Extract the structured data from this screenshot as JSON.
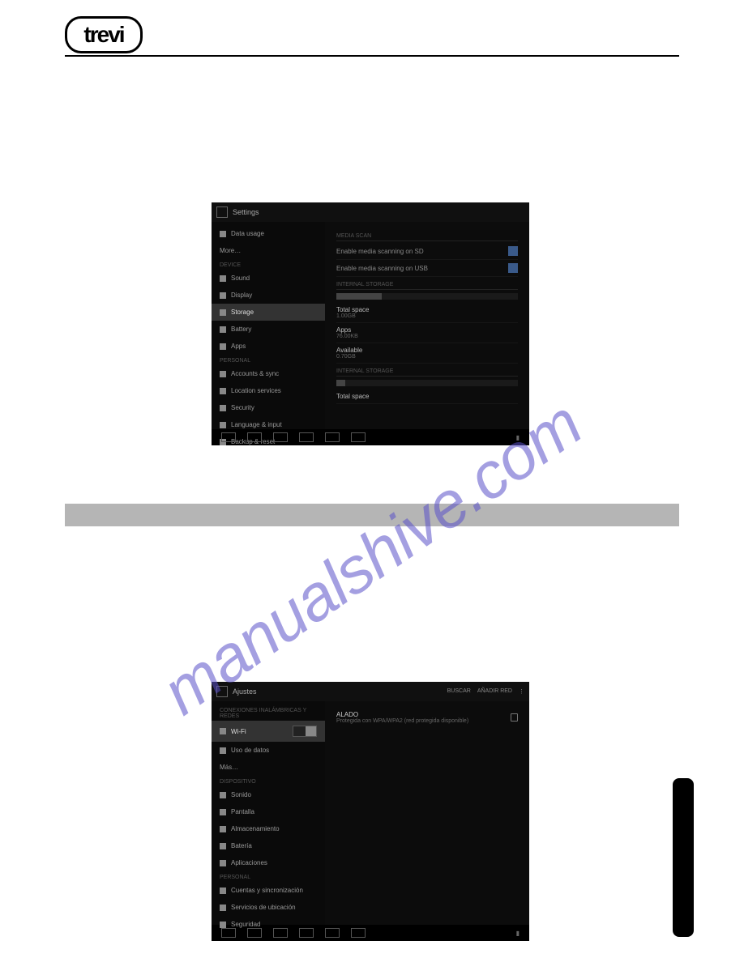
{
  "brand_logo_text": "trevi",
  "watermark_text": "manualshive.com",
  "screenshot1": {
    "title": "Settings",
    "left_items": [
      {
        "label": "Data usage",
        "category": false,
        "selected": false
      },
      {
        "label": "More…",
        "category": false,
        "selected": false
      },
      {
        "label": "DEVICE",
        "category": true
      },
      {
        "label": "Sound",
        "category": false,
        "selected": false
      },
      {
        "label": "Display",
        "category": false,
        "selected": false
      },
      {
        "label": "Storage",
        "category": false,
        "selected": true
      },
      {
        "label": "Battery",
        "category": false,
        "selected": false
      },
      {
        "label": "Apps",
        "category": false,
        "selected": false
      },
      {
        "label": "PERSONAL",
        "category": true
      },
      {
        "label": "Accounts & sync",
        "category": false,
        "selected": false
      },
      {
        "label": "Location services",
        "category": false,
        "selected": false
      },
      {
        "label": "Security",
        "category": false,
        "selected": false
      },
      {
        "label": "Language & input",
        "category": false,
        "selected": false
      },
      {
        "label": "Backup & reset",
        "category": false,
        "selected": false
      }
    ],
    "right": {
      "media_scan_section": "MEDIA SCAN",
      "scan_sd_label": "Enable media scanning on SD",
      "scan_usb_label": "Enable media scanning on USB",
      "internal_section": "INTERNAL STORAGE",
      "bar1_fill_pct": 25,
      "total_space_label": "Total space",
      "total_space_value": "1.00GB",
      "apps_label": "Apps",
      "apps_value": "76.00KB",
      "available_label": "Available",
      "available_value": "0.70GB",
      "internal2_section": "INTERNAL STORAGE",
      "bar2_fill_pct": 5,
      "total_space2_label": "Total space",
      "total_space2_value": ""
    }
  },
  "screenshot2": {
    "title": "Ajustes",
    "action_buscar": "BUSCAR",
    "action_anadir": "AÑADIR RED",
    "left_section_header": "CONEXIONES INALÁMBRICAS Y REDES",
    "left_items": [
      {
        "label": "Wi-Fi",
        "selected": true,
        "toggle": true
      },
      {
        "label": "Uso de datos",
        "selected": false
      },
      {
        "label": "Más…",
        "selected": false
      },
      {
        "label": "DISPOSITIVO",
        "category": true
      },
      {
        "label": "Sonido",
        "selected": false
      },
      {
        "label": "Pantalla",
        "selected": false
      },
      {
        "label": "Almacenamiento",
        "selected": false
      },
      {
        "label": "Batería",
        "selected": false
      },
      {
        "label": "Aplicaciones",
        "selected": false
      },
      {
        "label": "PERSONAL",
        "category": true
      },
      {
        "label": "Cuentas y sincronización",
        "selected": false
      },
      {
        "label": "Servicios de ubicación",
        "selected": false
      },
      {
        "label": "Seguridad",
        "selected": false
      }
    ],
    "network": {
      "name": "ALADO",
      "subtitle": "Protegida con WPA/WPA2 (red protegida disponible)"
    }
  }
}
